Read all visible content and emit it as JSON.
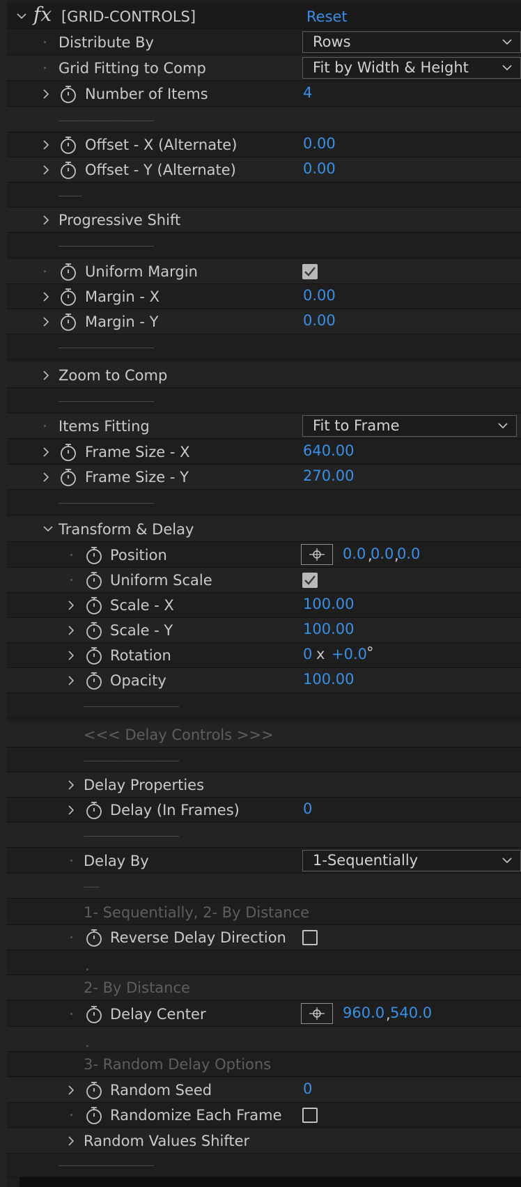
{
  "effect": {
    "title": "[GRID-CONTROLS]",
    "reset_label": "Reset"
  },
  "controls": {
    "distribute_by": {
      "label": "Distribute By",
      "value": "Rows"
    },
    "grid_fitting": {
      "label": "Grid Fitting to Comp",
      "value": "Fit by Width & Height"
    },
    "number_of_items": {
      "label": "Number of Items",
      "value": "4"
    },
    "sep1": "-------------------------------------",
    "offset_x": {
      "label": "Offset - X (Alternate)",
      "value": "0.00"
    },
    "offset_y": {
      "label": "Offset - Y (Alternate)",
      "value": "0.00"
    },
    "sep2": "---------",
    "progressive_shift": {
      "label": "Progressive Shift"
    },
    "sep3": "-------------------------------------",
    "uniform_margin": {
      "label": "Uniform Margin",
      "checked": true
    },
    "margin_x": {
      "label": "Margin - X",
      "value": "0.00"
    },
    "margin_y": {
      "label": "Margin - Y",
      "value": "0.00"
    },
    "sep4": "-------------------------------------",
    "zoom_to_comp": {
      "label": "Zoom to Comp"
    },
    "sep5": "-------------------------------------",
    "items_fitting": {
      "label": "Items Fitting",
      "value": "Fit to Frame"
    },
    "frame_size_x": {
      "label": "Frame Size - X",
      "value": "640.00"
    },
    "frame_size_y": {
      "label": "Frame Size - Y",
      "value": "270.00"
    },
    "sep6": "-------------------------------------",
    "transform_delay": {
      "label": "Transform & Delay"
    },
    "position": {
      "label": "Position",
      "x": "0.0",
      "y": "0.0",
      "z": "0.0"
    },
    "uniform_scale": {
      "label": "Uniform Scale",
      "checked": true
    },
    "scale_x": {
      "label": "Scale - X",
      "value": "100.00"
    },
    "scale_y": {
      "label": "Scale - Y",
      "value": "100.00"
    },
    "rotation": {
      "label": "Rotation",
      "revolutions": "0",
      "x_sep": "x",
      "degrees": "+0.0",
      "unit": "°"
    },
    "opacity": {
      "label": "Opacity",
      "value": "100.00"
    },
    "sep7": "-------------------------------------",
    "delay_controls_heading": "<<< Delay Controls >>>",
    "sep8": "-------------------------------------",
    "delay_properties": {
      "label": "Delay Properties"
    },
    "delay_in_frames": {
      "label": "Delay (In Frames)",
      "value": "0"
    },
    "sep9": "-------------------------------------",
    "delay_by": {
      "label": "Delay By",
      "value": "1-Sequentially"
    },
    "sep10": "------",
    "note_seq": "1- Sequentially, 2- By Distance",
    "reverse_delay": {
      "label": "Reverse Delay Direction",
      "checked": false
    },
    "note_dot1": ".",
    "note_by_distance": "2- By Distance",
    "delay_center": {
      "label": "Delay Center",
      "x": "960.0",
      "y": "540.0"
    },
    "note_dot2": ".",
    "note_random": "3- Random Delay Options",
    "random_seed": {
      "label": "Random Seed",
      "value": "0"
    },
    "randomize_each_frame": {
      "label": "Randomize Each Frame",
      "checked": false
    },
    "random_values_shifter": {
      "label": "Random Values Shifter"
    },
    "sep11": "-------------------------------------"
  }
}
